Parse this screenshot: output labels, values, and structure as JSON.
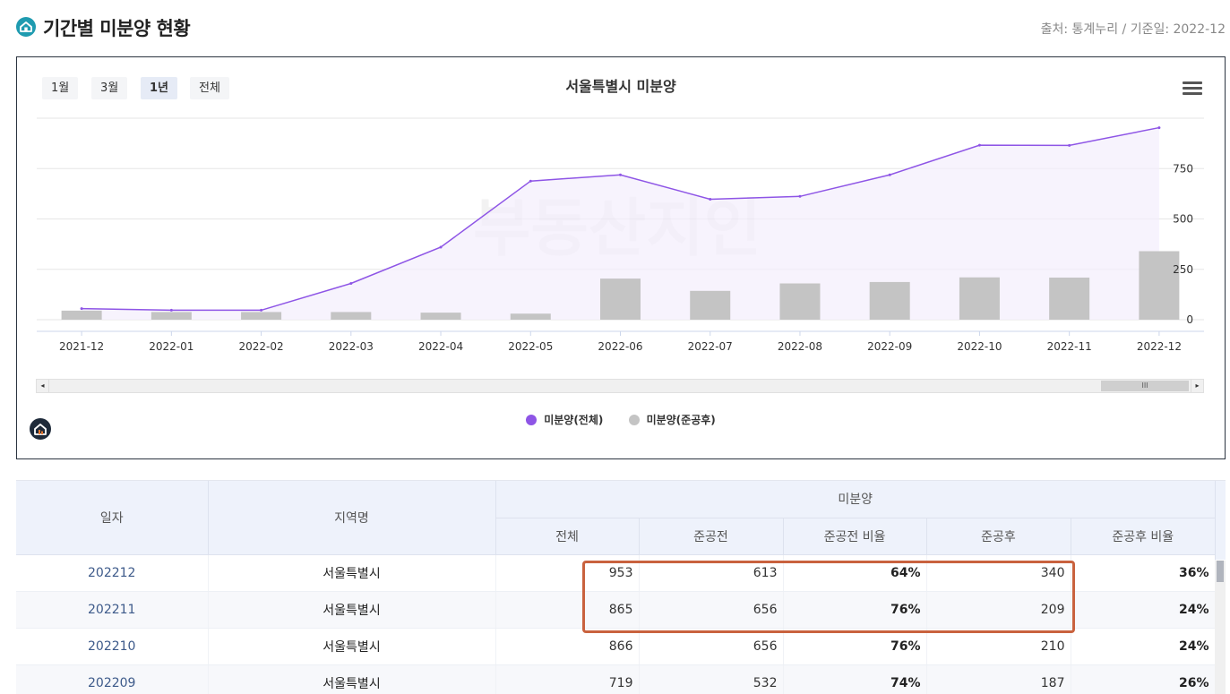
{
  "header": {
    "title": "기간별 미분양 현황",
    "source": "출처: 통계누리 / 기준일: 2022-12",
    "logo_icon": "house-icon"
  },
  "chart_controls": {
    "range_buttons": [
      "1월",
      "3월",
      "1년",
      "전체"
    ],
    "active_range": "1년",
    "menu_icon": "hamburger-menu-icon"
  },
  "watermark": "부동산지인",
  "scrollbar": {
    "thumb_label": "III",
    "left_arrow": "◂",
    "right_arrow": "▸"
  },
  "colors": {
    "line": "#8e55e6",
    "area_fill": "#f3eefc",
    "bar": "#c4c4c4",
    "grid": "#e6e6e6",
    "highlight_border": "#c9623e",
    "header_bg": "#eef2fb"
  },
  "chart_data": {
    "type": "bar",
    "title": "서울특별시 미분양",
    "categories": [
      "2021-12",
      "2022-01",
      "2022-02",
      "2022-03",
      "2022-04",
      "2022-05",
      "2022-06",
      "2022-07",
      "2022-08",
      "2022-09",
      "2022-10",
      "2022-11",
      "2022-12"
    ],
    "series": [
      {
        "name": "미분양(전체)",
        "type": "line",
        "color": "#8e55e6",
        "values": [
          55,
          47,
          47,
          180,
          360,
          688,
          719,
          598,
          612,
          719,
          866,
          865,
          953
        ]
      },
      {
        "name": "미분양(준공후)",
        "type": "bar",
        "color": "#c4c4c4",
        "values": [
          45,
          38,
          38,
          38,
          35,
          30,
          204,
          143,
          180,
          187,
          210,
          209,
          340
        ]
      }
    ],
    "y_ticks": [
      0,
      250,
      500,
      750
    ],
    "ylim": [
      0,
      1000
    ],
    "grid": true,
    "legend_position": "bottom"
  },
  "table": {
    "group_header": "미분양",
    "col_date": "일자",
    "col_region": "지역명",
    "sub_headers": [
      "전체",
      "준공전",
      "준공전 비율",
      "준공후",
      "준공후 비율"
    ],
    "rows": [
      {
        "date": "202212",
        "region": "서울특별시",
        "total": "953",
        "pre": "613",
        "pre_ratio": "64%",
        "post": "340",
        "post_ratio": "36%"
      },
      {
        "date": "202211",
        "region": "서울특별시",
        "total": "865",
        "pre": "656",
        "pre_ratio": "76%",
        "post": "209",
        "post_ratio": "24%"
      },
      {
        "date": "202210",
        "region": "서울특별시",
        "total": "866",
        "pre": "656",
        "pre_ratio": "76%",
        "post": "210",
        "post_ratio": "24%"
      },
      {
        "date": "202209",
        "region": "서울특별시",
        "total": "719",
        "pre": "532",
        "pre_ratio": "74%",
        "post": "187",
        "post_ratio": "26%"
      }
    ]
  }
}
